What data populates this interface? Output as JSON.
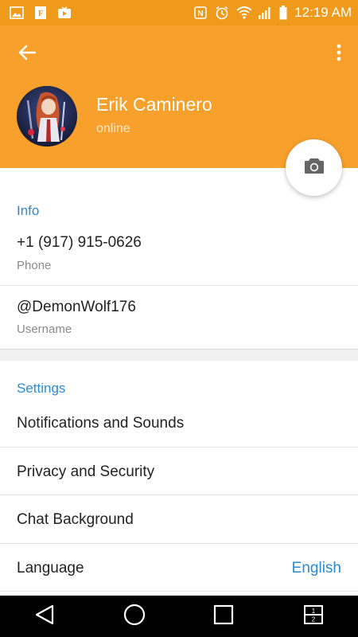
{
  "status_bar": {
    "time": "12:19 AM",
    "icons": [
      "image-icon",
      "news-icon",
      "youtube-icon",
      "nfc-icon",
      "alarm-icon",
      "wifi-icon",
      "signal-icon",
      "battery-icon"
    ]
  },
  "header": {
    "back_icon": "arrow-left-icon",
    "menu_icon": "more-vert-icon",
    "name": "Erik Caminero",
    "status": "online",
    "camera_icon": "camera-icon"
  },
  "info": {
    "title": "Info",
    "phone_value": "+1 (917) 915-0626",
    "phone_label": "Phone",
    "username_value": "@DemonWolf176",
    "username_label": "Username"
  },
  "settings": {
    "title": "Settings",
    "items": [
      {
        "label": "Notifications and Sounds"
      },
      {
        "label": "Privacy and Security"
      },
      {
        "label": "Chat Background"
      },
      {
        "label": "Language",
        "value": "English"
      }
    ]
  },
  "nav_bar": {
    "icons": [
      "back-triangle-icon",
      "home-circle-icon",
      "recents-square-icon",
      "dual-window-icon"
    ]
  },
  "colors": {
    "status_bar": "#f09a1c",
    "header": "#f7a02b",
    "accent_blue": "#2a8bd2"
  }
}
